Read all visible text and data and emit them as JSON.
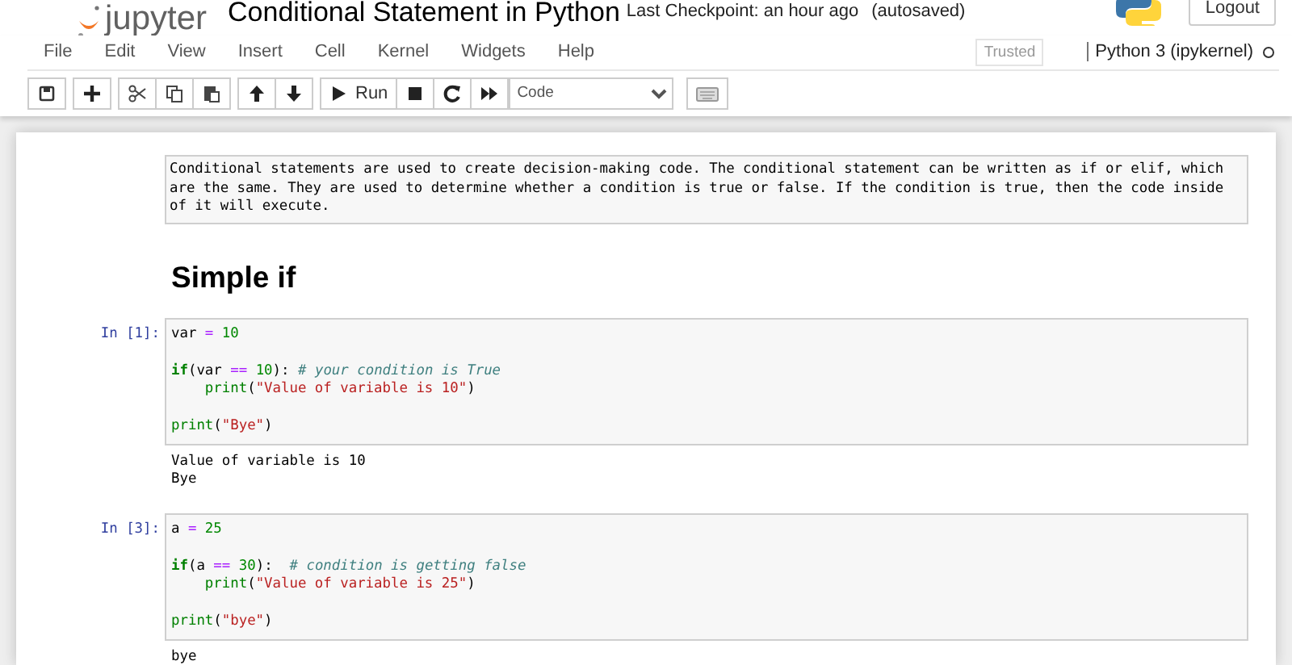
{
  "header": {
    "logo_text": "jupyter",
    "title": "Conditional Statement in Python",
    "checkpoint": "Last Checkpoint: an hour ago",
    "autosave": "(autosaved)",
    "logout": "Logout"
  },
  "menu": [
    "File",
    "Edit",
    "View",
    "Insert",
    "Cell",
    "Kernel",
    "Widgets",
    "Help"
  ],
  "toolbar": {
    "groups": [
      [
        {
          "kind": "save"
        }
      ],
      [
        {
          "kind": "insert"
        }
      ],
      [
        {
          "kind": "cut"
        },
        {
          "kind": "copy"
        },
        {
          "kind": "paste"
        }
      ],
      [
        {
          "kind": "up"
        },
        {
          "kind": "down"
        }
      ],
      [
        {
          "kind": "run",
          "label": "Run"
        },
        {
          "kind": "stop"
        },
        {
          "kind": "restart"
        },
        {
          "kind": "fast_forward"
        }
      ]
    ],
    "cell_type": "Code",
    "trusted": "Trusted",
    "kernel": "Python 3 (ipykernel)",
    "kernel_busy": false
  },
  "cells": [
    {
      "kind": "markdown",
      "text": "Conditional statements are used to create decision-making code. The conditional statement can be written as if or elif, which are the same. They are used to determine whether a condition is true or false. If the condition is true, then the code inside of it will execute."
    },
    {
      "kind": "heading",
      "text": "Simple if"
    },
    {
      "kind": "code",
      "prompt": "In [1]:",
      "lines": [
        {
          "tokens": [
            {
              "kind": "name",
              "s": "var "
            },
            {
              "kind": "op",
              "s": "="
            },
            {
              "kind": "number",
              "s": " 10"
            }
          ]
        },
        {
          "blank": true
        },
        {
          "tokens": [
            {
              "kind": "keyword",
              "s": "if"
            },
            {
              "kind": "name",
              "s": "(var "
            },
            {
              "kind": "op",
              "s": "=="
            },
            {
              "kind": "number",
              "s": " 10"
            },
            {
              "kind": "name",
              "s": "): "
            },
            {
              "kind": "comment",
              "s": "# your condition is True"
            }
          ]
        },
        {
          "tokens": [
            {
              "kind": "builtin",
              "s": "    print"
            },
            {
              "kind": "name",
              "s": "("
            },
            {
              "kind": "string",
              "s": "\"Value of variable is 10\""
            },
            {
              "kind": "name",
              "s": ")"
            }
          ]
        },
        {
          "blank": true
        },
        {
          "tokens": [
            {
              "kind": "builtin",
              "s": "print"
            },
            {
              "kind": "name",
              "s": "("
            },
            {
              "kind": "string",
              "s": "\"Bye\""
            },
            {
              "kind": "name",
              "s": ")"
            }
          ]
        }
      ],
      "output": [
        "Value of variable is 10",
        "Bye"
      ]
    },
    {
      "kind": "code",
      "prompt": "In [3]:",
      "lines": [
        {
          "tokens": [
            {
              "kind": "name",
              "s": "a "
            },
            {
              "kind": "op",
              "s": "="
            },
            {
              "kind": "number",
              "s": " 25"
            }
          ]
        },
        {
          "blank": true
        },
        {
          "tokens": [
            {
              "kind": "keyword",
              "s": "if"
            },
            {
              "kind": "name",
              "s": "(a "
            },
            {
              "kind": "op",
              "s": "=="
            },
            {
              "kind": "number",
              "s": " 30"
            },
            {
              "kind": "name",
              "s": "):  "
            },
            {
              "kind": "comment",
              "s": "# condition is getting false"
            }
          ]
        },
        {
          "tokens": [
            {
              "kind": "builtin",
              "s": "    print"
            },
            {
              "kind": "name",
              "s": "("
            },
            {
              "kind": "string",
              "s": "\"Value of variable is 25\""
            },
            {
              "kind": "name",
              "s": ")"
            }
          ]
        },
        {
          "blank": true
        },
        {
          "tokens": [
            {
              "kind": "builtin",
              "s": "print"
            },
            {
              "kind": "name",
              "s": "("
            },
            {
              "kind": "string",
              "s": "\"bye\""
            },
            {
              "kind": "name",
              "s": ")"
            }
          ]
        }
      ],
      "output": [
        "bye"
      ]
    }
  ]
}
